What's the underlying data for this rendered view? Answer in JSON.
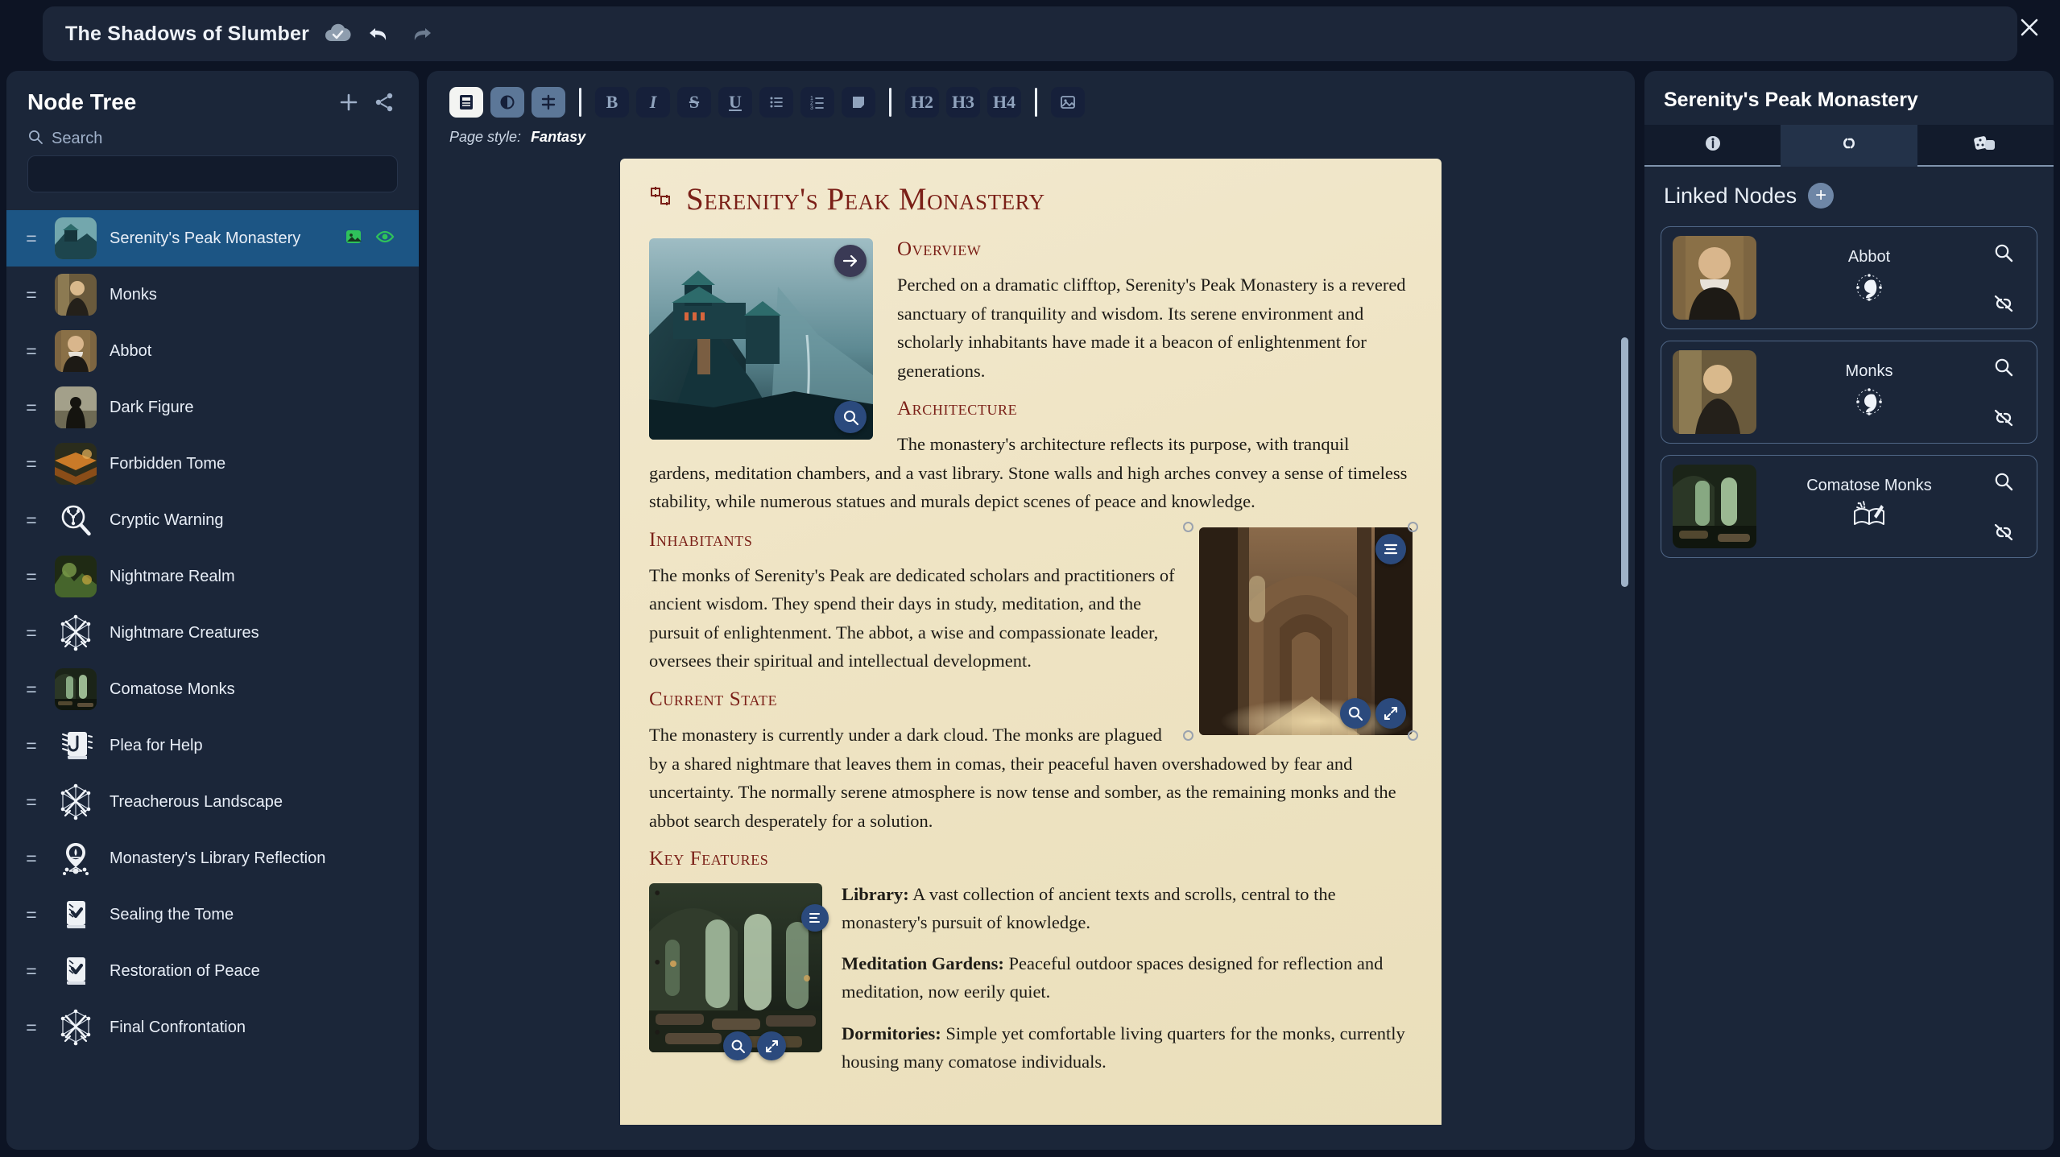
{
  "titlebar": {
    "project_title": "The Shadows of Slumber",
    "saved_icon": "cloud-check-icon",
    "undo_icon": "undo-icon",
    "redo_icon": "redo-icon",
    "close_icon": "close-icon"
  },
  "sidebar": {
    "title": "Node Tree",
    "add_label": "+",
    "share_icon": "share-icon",
    "search_placeholder": "Search",
    "search_value": "",
    "items": [
      {
        "label": "Serenity's Peak Monastery",
        "icon": "thumbnail-monastery",
        "selected": true,
        "actions": [
          "image-icon",
          "eye-icon"
        ]
      },
      {
        "label": "Monks",
        "icon": "thumbnail-monk",
        "selected": false,
        "actions": []
      },
      {
        "label": "Abbot",
        "icon": "thumbnail-abbot",
        "selected": false,
        "actions": []
      },
      {
        "label": "Dark Figure",
        "icon": "thumbnail-darkfigure",
        "selected": false,
        "actions": []
      },
      {
        "label": "Forbidden Tome",
        "icon": "thumbnail-tome",
        "selected": false,
        "actions": []
      },
      {
        "label": "Cryptic Warning",
        "icon": "clue-magnifier-icon",
        "selected": false,
        "actions": []
      },
      {
        "label": "Nightmare Realm",
        "icon": "thumbnail-realm",
        "selected": false,
        "actions": []
      },
      {
        "label": "Nightmare Creatures",
        "icon": "crossed-swords-icon",
        "selected": false,
        "actions": []
      },
      {
        "label": "Comatose Monks",
        "icon": "thumbnail-comatose",
        "selected": false,
        "actions": []
      },
      {
        "label": "Plea for Help",
        "icon": "book-hook-icon",
        "selected": false,
        "actions": []
      },
      {
        "label": "Treacherous Landscape",
        "icon": "crossed-swords-icon",
        "selected": false,
        "actions": []
      },
      {
        "label": "Monastery's Library Reflection",
        "icon": "map-pin-icon",
        "selected": false,
        "actions": []
      },
      {
        "label": "Sealing the Tome",
        "icon": "book-check-icon",
        "selected": false,
        "actions": []
      },
      {
        "label": "Restoration of Peace",
        "icon": "book-check-icon",
        "selected": false,
        "actions": []
      },
      {
        "label": "Final Confrontation",
        "icon": "crossed-swords-icon",
        "selected": false,
        "actions": []
      }
    ]
  },
  "editor": {
    "toolbar": [
      {
        "name": "view-page-button",
        "icon": "page-icon",
        "state": "active"
      },
      {
        "name": "view-contrast-button",
        "icon": "contrast-icon",
        "state": "mid"
      },
      {
        "name": "view-layout-button",
        "icon": "layout-icon",
        "state": "mid"
      },
      {
        "name": "bold-button",
        "icon": "bold-icon",
        "label": "B"
      },
      {
        "name": "italic-button",
        "icon": "italic-icon",
        "label": "I"
      },
      {
        "name": "strikethrough-button",
        "icon": "strikethrough-icon",
        "label": "S"
      },
      {
        "name": "underline-button",
        "icon": "underline-icon",
        "label": "U"
      },
      {
        "name": "bullet-list-button",
        "icon": "bullet-list-icon"
      },
      {
        "name": "numbered-list-button",
        "icon": "numbered-list-icon"
      },
      {
        "name": "note-button",
        "icon": "note-icon"
      },
      {
        "name": "heading-2-button",
        "icon": "h2-icon",
        "label": "H2"
      },
      {
        "name": "heading-3-button",
        "icon": "h3-icon",
        "label": "H3"
      },
      {
        "name": "heading-4-button",
        "icon": "h4-icon",
        "label": "H4"
      },
      {
        "name": "insert-image-button",
        "icon": "image-icon"
      }
    ],
    "page_style_label": "Page style:",
    "page_style_value": "Fantasy",
    "document": {
      "title": "Serenity's Peak Monastery",
      "title_icon": "node-glyph-icon",
      "sections": [
        {
          "heading": "Overview",
          "paragraph": "Perched on a dramatic clifftop, Serenity's Peak Monastery is a revered sanctuary of tranquility and wisdom. Its serene environment and scholarly inhabitants have made it a beacon of enlightenment for generations."
        },
        {
          "heading": "Architecture",
          "paragraph": "The monastery's architecture reflects its purpose, with tranquil gardens, meditation chambers, and a vast library. Stone walls and high arches convey a sense of timeless stability, while numerous statues and murals depict scenes of peace and knowledge."
        },
        {
          "heading": "Inhabitants",
          "paragraph": "The monks of Serenity's Peak are dedicated scholars and practitioners of ancient wisdom. They spend their days in study, meditation, and the pursuit of enlightenment. The abbot, a wise and compassionate leader, oversees their spiritual and intellectual development."
        },
        {
          "heading": "Current State",
          "paragraph": "The monastery is currently under a dark cloud. The monks are plagued by a shared nightmare that leaves them in comas, their peaceful haven overshadowed by fear and uncertainty. The normally serene atmosphere is now tense and somber, as the remaining monks and the abbot search desperately for a solution."
        },
        {
          "heading": "Key Features",
          "bullets": [
            {
              "term": "Library:",
              "text": " A vast collection of ancient texts and scrolls, central to the monastery's pursuit of knowledge."
            },
            {
              "term": "Meditation Gardens:",
              "text": " Peaceful outdoor spaces designed for reflection and meditation, now eerily quiet."
            },
            {
              "term": "Dormitories:",
              "text": " Simple yet comfortable living quarters for the monks, currently housing many comatose individuals."
            }
          ]
        }
      ],
      "images": [
        {
          "name": "monastery-cliff-image",
          "buttons": [
            "arrow-right-icon",
            "zoom-icon"
          ],
          "selected": false
        },
        {
          "name": "cathedral-hall-image",
          "buttons": [
            "align-icon",
            "zoom-icon",
            "expand-icon"
          ],
          "selected": true
        },
        {
          "name": "library-hall-image",
          "buttons": [
            "align-icon",
            "zoom-icon",
            "expand-icon"
          ],
          "selected": false
        }
      ]
    }
  },
  "right_panel": {
    "title": "Serenity's Peak Monastery",
    "tabs": [
      {
        "name": "tab-info",
        "icon": "info-icon",
        "active": false
      },
      {
        "name": "tab-links",
        "icon": "link-icon",
        "active": true
      },
      {
        "name": "tab-dice",
        "icon": "dice-icon",
        "active": false
      }
    ],
    "section_title": "Linked Nodes",
    "add_label": "+",
    "linked_nodes": [
      {
        "label": "Abbot",
        "thumb": "thumbnail-abbot",
        "type_icon": "character-icon",
        "actions": [
          "search-icon",
          "unlink-icon"
        ]
      },
      {
        "label": "Monks",
        "thumb": "thumbnail-monk",
        "type_icon": "character-icon",
        "actions": [
          "search-icon",
          "unlink-icon"
        ]
      },
      {
        "label": "Comatose Monks",
        "thumb": "thumbnail-comatose",
        "type_icon": "lore-book-icon",
        "actions": [
          "search-icon",
          "unlink-icon"
        ]
      }
    ]
  },
  "colors": {
    "app_bg": "#0d1424",
    "panel_bg": "#1b2639",
    "selected_row": "#1c5584",
    "accent_green": "#2fc25b",
    "parchment": "#efe4c4",
    "heading_red": "#7a1f17",
    "overlay_blue": "#2b4a7d"
  }
}
